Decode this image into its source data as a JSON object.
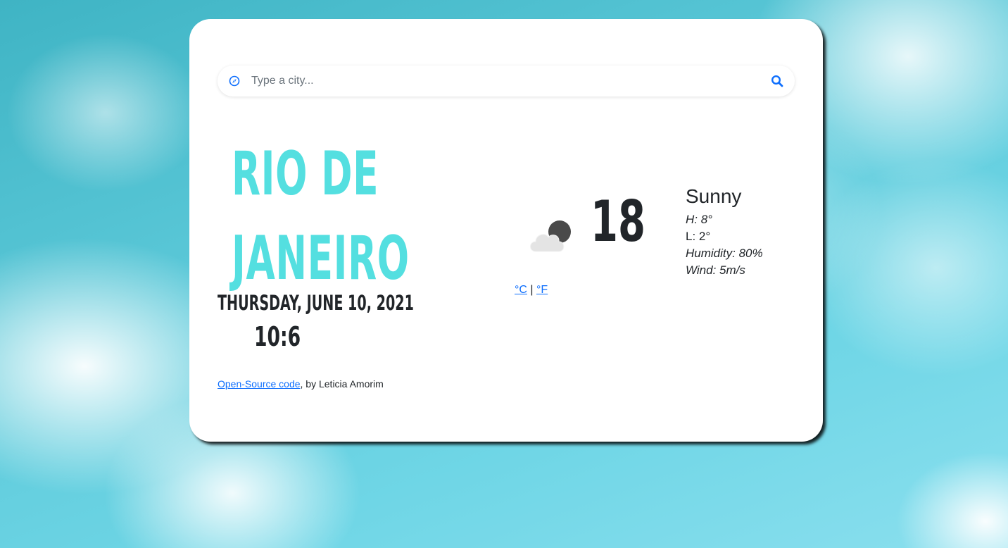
{
  "search": {
    "placeholder": "Type a city...",
    "value": "",
    "locate_icon": "compass-icon",
    "submit_icon": "search-icon"
  },
  "city": {
    "line1": "Rio de",
    "line2": "Janeiro"
  },
  "date": "Thursday, June 10, 2021",
  "time": "10:6",
  "current": {
    "temperature": "18",
    "icon": "cloud-night-icon",
    "description": "Sunny",
    "high": "H: 8°",
    "low": "L: 2°",
    "humidity": "Humidity: 80%",
    "wind": "Wind: 5m/s"
  },
  "units": {
    "celsius": "°C",
    "separator": "|",
    "fahrenheit": "°F"
  },
  "footer": {
    "link_text": "Open-Source code",
    "suffix": ", by Leticia Amorim"
  },
  "colors": {
    "accent": "#54dfe0",
    "link": "#0d6efd",
    "text": "#212529"
  }
}
